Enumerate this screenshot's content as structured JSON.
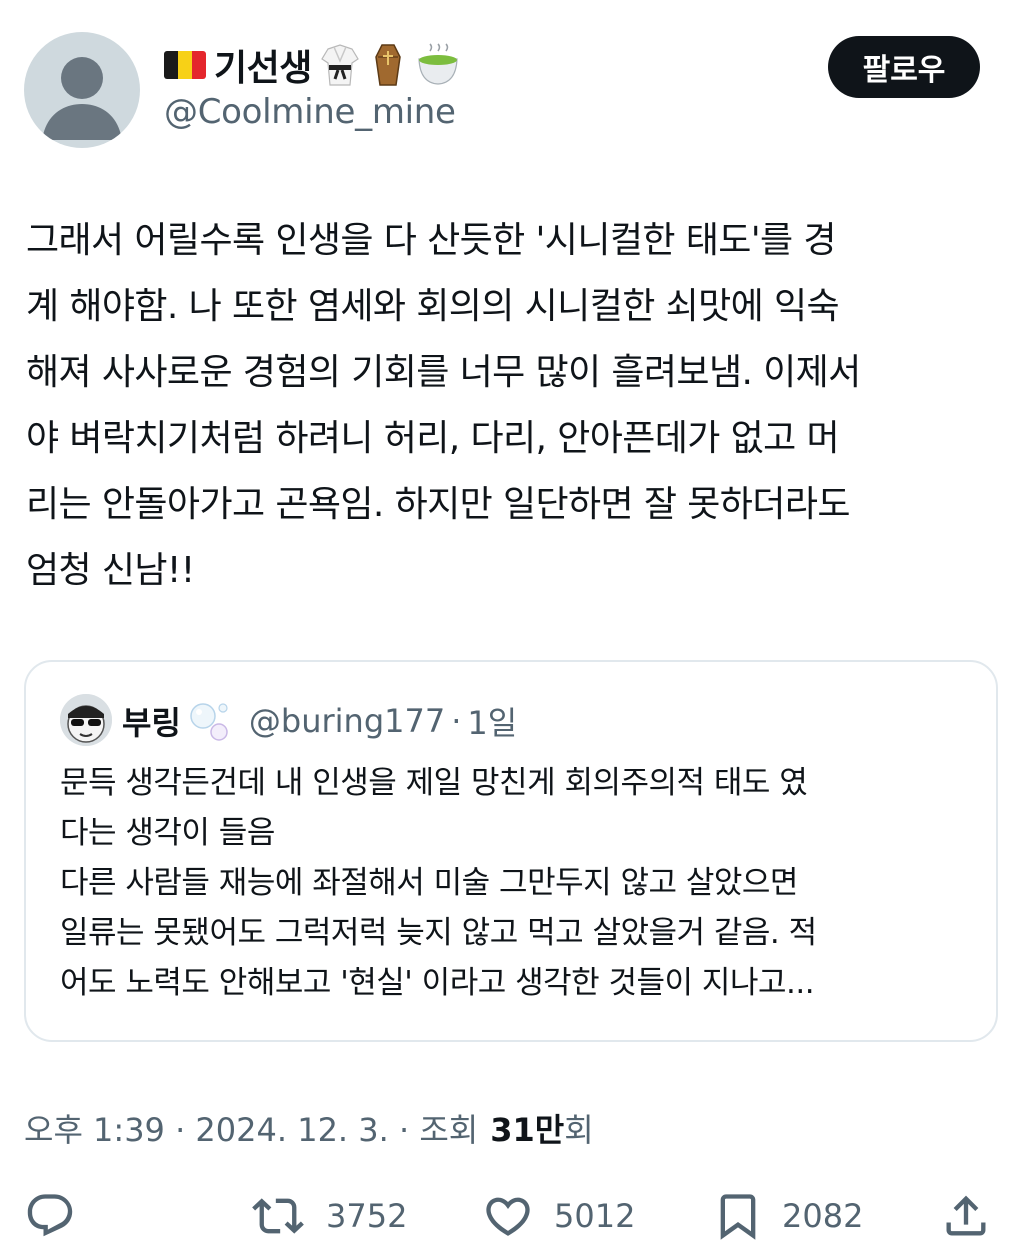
{
  "author": {
    "display_name": "기선생",
    "handle": "@Coolmine_mine",
    "emojis": [
      "flag-belgium-icon",
      "martial-arts-uniform-icon",
      "coffin-icon",
      "green-tea-icon"
    ]
  },
  "follow_label": "팔로우",
  "tweet": {
    "text": "그래서 어릴수록 인생을 다 산듯한 '시니컬한 태도'를 경\n계 해야함. 나 또한 염세와 회의의 시니컬한 쇠맛에 익숙\n해져 사사로운 경험의 기회를 너무 많이 흘려보냄. 이제서\n야 벼락치기처럼 하려니 허리, 다리,  안아픈데가 없고 머\n리는 안돌아가고 곤욕임. 하지만 일단하면 잘 못하더라도\n엄청 신남!!"
  },
  "quote": {
    "display_name": "부링",
    "handle": "@buring177",
    "separator": "·",
    "time": "1일",
    "text": "문득 생각든건데 내 인생을 제일 망친게 회의주의적 태도 였\n다는 생각이 들음\n다른 사람들 재능에 좌절해서 미술 그만두지 않고 살았으면\n일류는 못됐어도 그럭저럭 늦지 않고 먹고 살았을거 같음. 적\n어도 노력도 안해보고 '현실' 이라고 생각한 것들이 지나고..."
  },
  "meta": {
    "timestamp": "오후 1:39 · 2024. 12. 3. · 조회",
    "views": "31만",
    "views_suffix": "회"
  },
  "actions": {
    "reply": {
      "icon": "reply-icon"
    },
    "retweet": {
      "icon": "retweet-icon",
      "count": "3752"
    },
    "like": {
      "icon": "heart-icon",
      "count": "5012"
    },
    "bookmark": {
      "icon": "bookmark-icon",
      "count": "2082"
    },
    "share": {
      "icon": "share-icon"
    }
  },
  "colors": {
    "text_primary": "#0f1419",
    "text_secondary": "#536471",
    "border": "#e1e8ed",
    "avatar_placeholder": "#cfd9de",
    "button_bg": "#0f1419"
  }
}
